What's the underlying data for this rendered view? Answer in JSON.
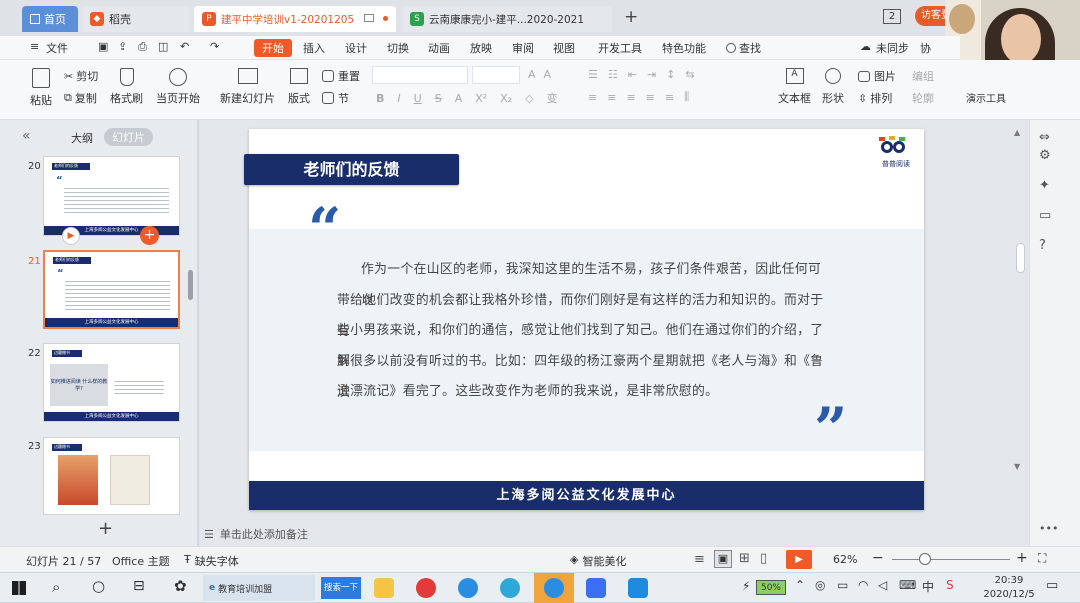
{
  "tabs": {
    "home": "首页",
    "docer": "稻壳",
    "active_doc": "建平中学培训v1-20201205",
    "other_doc": "云南康康完小-建平...2020-2021",
    "new_tab": "+",
    "count": "2",
    "visitor": "访客登"
  },
  "menu": {
    "file": "文件",
    "start": "开始",
    "insert": "插入",
    "design": "设计",
    "transition": "切换",
    "animation": "动画",
    "slideshow": "放映",
    "review": "审阅",
    "view": "视图",
    "devtools": "开发工具",
    "features": "特色功能",
    "search": "查找",
    "sync": "未同步",
    "collab": "协"
  },
  "ribbon": {
    "paste": "粘贴",
    "cut": "剪切",
    "copy": "复制",
    "format_painter": "格式刷",
    "from_current": "当页开始",
    "new_slide": "新建幻灯片",
    "layout": "版式",
    "reset": "重置",
    "section": "节",
    "font_btns": [
      "B",
      "I",
      "U",
      "S",
      "A",
      "X²",
      "X₂",
      "◇",
      "变"
    ],
    "textbox": "文本框",
    "shape": "形状",
    "image": "图片",
    "arrange": "排列",
    "align": "编组",
    "outline": "轮廓",
    "display": "演示工具"
  },
  "panel": {
    "outline_tab": "大纲",
    "slides_tab": "幻灯片",
    "slides": [
      {
        "num": "20",
        "title": "老师们的反馈"
      },
      {
        "num": "21",
        "title": "老师们的反馈"
      },
      {
        "num": "22",
        "title": "边疆赠书"
      },
      {
        "num": "23",
        "title": "边疆赠书"
      }
    ],
    "thumb_q": "如何推进阅读 什么样的教学?",
    "footer_mini": "上海多阅公益文化发展中心",
    "add": "+"
  },
  "slide": {
    "title": "老师们的反馈",
    "open_quote": "“",
    "close_quote": "”",
    "lines": [
      "作为一个在山区的老师，我深知这里的生活不易，孩子们条件艰苦，因此任何可以",
      "带给他们改变的机会都让我格外珍惜，而你们刚好是有这样的活力和知识的。而对于有",
      "些小男孩来说，和你们的通信，感觉让他们找到了知己。他们在通过你们的介绍，了解",
      "到很多以前没有听过的书。比如：四年级的杨江豪两个星期就把《老人与海》和《鲁滨",
      "逊漂流记》看完了。这些改变作为老师的我来说，是非常欣慰的。"
    ],
    "footer": "上海多阅公益文化发展中心",
    "logo_text": "普普阅读"
  },
  "notes_placeholder": "单击此处添加备注",
  "status": {
    "slide_counter": "幻灯片 21 / 57",
    "theme": "Office 主题",
    "missing_font": "缺失字体",
    "beautify": "智能美化",
    "zoom": "62%",
    "minus": "−",
    "plus": "+"
  },
  "taskbar": {
    "app1": "教育培训加盟",
    "search_btn": "搜索一下",
    "battery": "50%",
    "ime": "中",
    "time": "20:39",
    "date": "2020/12/5"
  },
  "colors": {
    "navy": "#1a2d6b",
    "accent_orange": "#f05a28",
    "quote_blue": "#2a5aa8",
    "slide_band": "#eef3f8",
    "active_tab_orange": "#e95a2b"
  }
}
